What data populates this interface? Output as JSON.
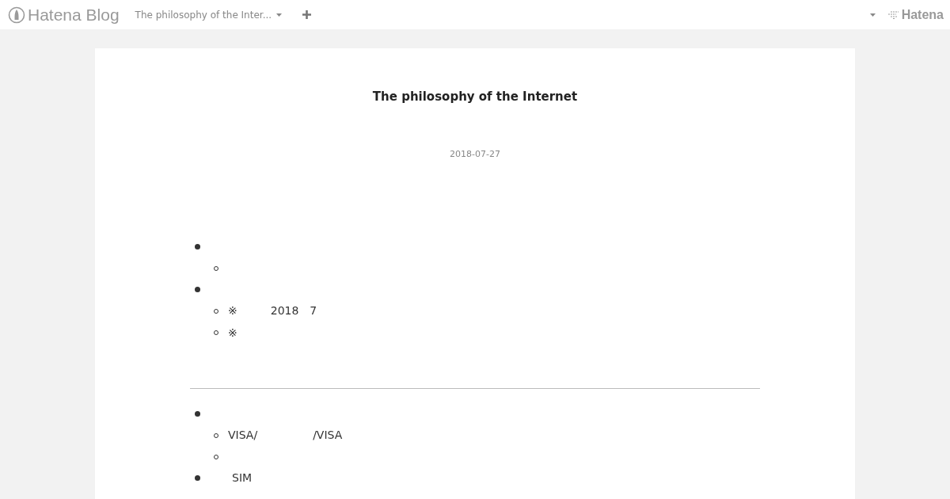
{
  "header": {
    "logo": "Hatena Blog",
    "blog_title": "The philosophy of the Inter...",
    "brand": "Hatena"
  },
  "article": {
    "title": "The philosophy of the Internet",
    "date": "2018-07-27",
    "sections": [
      {
        "items": [
          {
            "kind": "disc",
            "children": [
              {
                "kind": "circle"
              }
            ]
          },
          {
            "kind": "disc",
            "children": [
              {
                "kind": "circle",
                "text": "※　　　2018　7"
              },
              {
                "kind": "circle",
                "text": "※"
              }
            ]
          }
        ]
      },
      {
        "items": [
          {
            "kind": "disc",
            "children": [
              {
                "kind": "circle",
                "text": "VISA/　　　　　/VISA"
              },
              {
                "kind": "circle"
              }
            ]
          },
          {
            "kind": "disc",
            "text": "　　SIM"
          }
        ]
      }
    ]
  }
}
